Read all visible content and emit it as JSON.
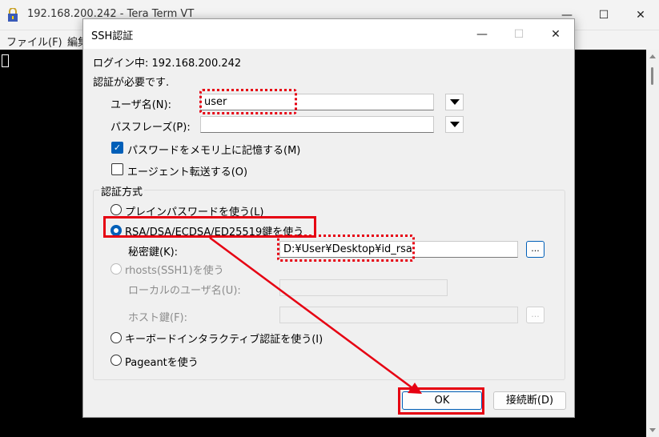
{
  "terminal_window": {
    "title": "192.168.200.242 - Tera Term VT",
    "window_controls": {
      "minimize": "—",
      "maximize": "☐",
      "close": "✕"
    },
    "menu": [
      "ファイル(F)",
      "編集"
    ],
    "icons": {
      "app": "tera-term-lock-icon"
    }
  },
  "dialog": {
    "title": "SSH認証",
    "window_controls": {
      "minimize": "—",
      "maximize": "☐",
      "close": "✕"
    },
    "login_line": "ログイン中: 192.168.200.242",
    "auth_required": "認証が必要です.",
    "username": {
      "label": "ユーザ名(N):",
      "value": "user"
    },
    "passphrase": {
      "label": "パスフレーズ(P):",
      "value": ""
    },
    "remember_password": {
      "label": "パスワードをメモリ上に記憶する(M)",
      "checked": true,
      "check_glyph": "✓"
    },
    "agent_forwarding": {
      "label": "エージェント転送する(O)",
      "checked": false
    },
    "auth_method": {
      "title": "認証方式",
      "plain_password": {
        "label": "プレインパスワードを使う(L)",
        "selected": false
      },
      "rsa": {
        "label": "RSA/DSA/ECDSA/ED25519鍵を使う",
        "selected": true
      },
      "private_key": {
        "label": "秘密鍵(K):",
        "value": "D:¥User¥Desktop¥id_rsa",
        "browse_label": "..."
      },
      "rhosts": {
        "label": "rhosts(SSH1)を使う",
        "selected": false,
        "enabled": false
      },
      "local_user": {
        "label": "ローカルのユーザ名(U):",
        "value": ""
      },
      "host_key": {
        "label": "ホスト鍵(F):",
        "value": "",
        "browse_label": "..."
      },
      "keyboard_interactive": {
        "label": "キーボードインタラクティブ認証を使う(I)",
        "selected": false
      },
      "pageant": {
        "label": "Pageantを使う",
        "selected": false
      }
    },
    "ok_label": "OK",
    "disconnect_label": "接続断(D)"
  },
  "colors": {
    "annotation": "#e60012",
    "accent": "#005fb8"
  }
}
